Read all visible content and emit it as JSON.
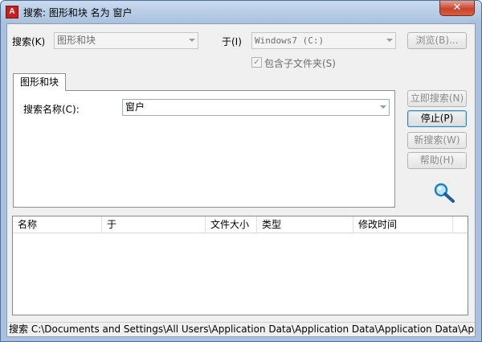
{
  "window": {
    "title": "搜索: 图形和块 名为 窗户",
    "app_icon_letter": "A"
  },
  "controls": {
    "close_symbol": "✕"
  },
  "search_type": {
    "label": "搜索(K)",
    "value": "图形和块"
  },
  "location": {
    "label": "于(I)",
    "value": "Windows7 (C:)",
    "browse_label": "浏览(B)..."
  },
  "include_subfolders": {
    "label": "包含子文件夹(S)",
    "checked": true,
    "check_mark": "✓"
  },
  "tab": {
    "label": "图形和块"
  },
  "search_name": {
    "label": "搜索名称(C):",
    "value": "窗户"
  },
  "buttons": {
    "search_now": "立即搜索(N)",
    "stop": "停止(P)",
    "new_search": "新搜索(W)",
    "help": "帮助(H)"
  },
  "results": {
    "columns": [
      "名称",
      "于",
      "文件大小",
      "类型",
      "修改时间"
    ],
    "rows": []
  },
  "status": {
    "text": "搜索 C:\\Documents and Settings\\All Users\\Application Data\\Application Data\\Application Data\\Ap"
  },
  "colors": {
    "accent": "#3c7fb1",
    "close": "#c7452d",
    "icon_red": "#c8201c"
  }
}
